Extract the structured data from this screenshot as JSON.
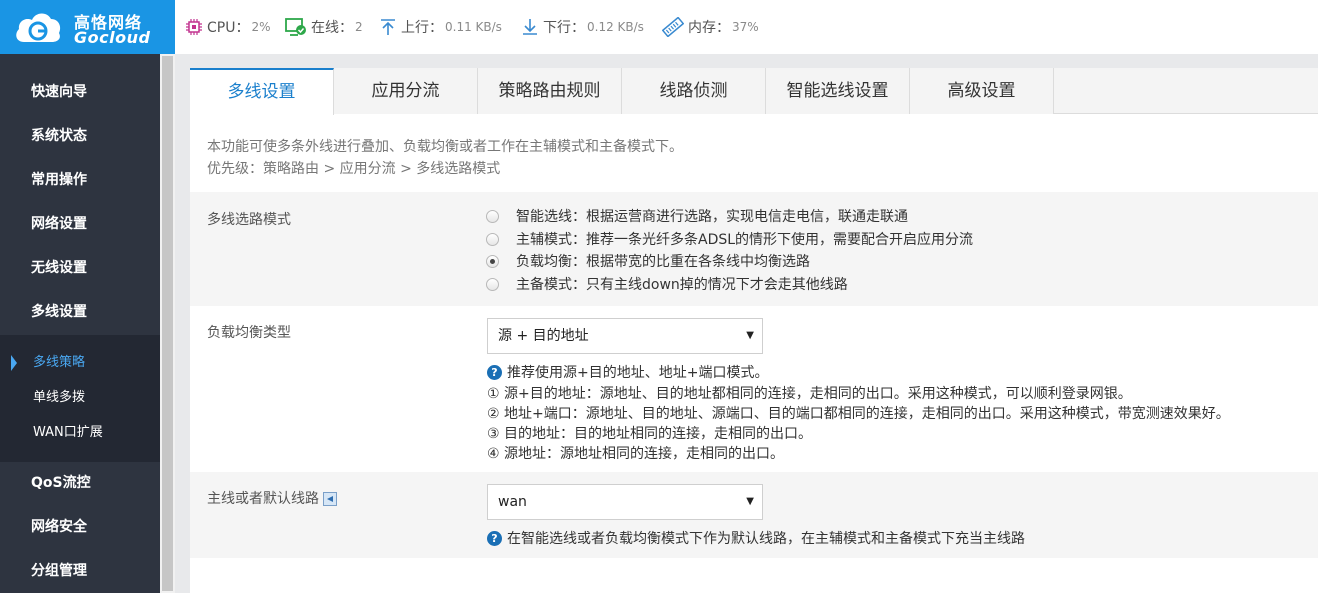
{
  "brand": {
    "name_cn": "高恪网络",
    "name_en": "Gocloud"
  },
  "status": {
    "cpu": {
      "label": "CPU：",
      "value": "2%"
    },
    "online": {
      "label": "在线：",
      "value": "2"
    },
    "upload": {
      "label": "上行：",
      "value": "0.11 KB/s"
    },
    "download": {
      "label": "下行：",
      "value": "0.12 KB/s"
    },
    "memory": {
      "label": "内存：",
      "value": "37%"
    }
  },
  "sidebar": {
    "items": [
      {
        "label": "快速向导"
      },
      {
        "label": "系统状态"
      },
      {
        "label": "常用操作"
      },
      {
        "label": "网络设置"
      },
      {
        "label": "无线设置"
      },
      {
        "label": "多线设置"
      }
    ],
    "sub_items": [
      {
        "label": "多线策略",
        "active": true
      },
      {
        "label": "单线多拨"
      },
      {
        "label": "WAN口扩展"
      }
    ],
    "items_after": [
      {
        "label": "QoS流控"
      },
      {
        "label": "网络安全"
      },
      {
        "label": "分组管理"
      }
    ]
  },
  "tabs": [
    {
      "label": "多线设置",
      "active": true
    },
    {
      "label": "应用分流"
    },
    {
      "label": "策略路由规则"
    },
    {
      "label": "线路侦测"
    },
    {
      "label": "智能选线设置"
    },
    {
      "label": "高级设置"
    }
  ],
  "description": {
    "line1": "本功能可使多条外线进行叠加、负载均衡或者工作在主辅模式和主备模式下。",
    "line2": "优先级：策略路由 > 应用分流 > 多线选路模式"
  },
  "mode_section": {
    "label": "多线选路模式",
    "options": [
      {
        "label": "智能选线：根据运营商进行选路，实现电信走电信，联通走联通",
        "checked": false
      },
      {
        "label": "主辅模式：推荐一条光纤多条ADSL的情形下使用，需要配合开启应用分流",
        "checked": false
      },
      {
        "label": "负载均衡：根据带宽的比重在各条线中均衡选路",
        "checked": true
      },
      {
        "label": "主备模式：只有主线down掉的情况下才会走其他线路",
        "checked": false
      }
    ]
  },
  "balance_section": {
    "label": "负载均衡类型",
    "select_value": "源 + 目的地址",
    "help": "推荐使用源+目的地址、地址+端口模式。",
    "notes": [
      "① 源+目的地址：源地址、目的地址都相同的连接，走相同的出口。采用这种模式，可以顺利登录网银。",
      "② 地址+端口：源地址、目的地址、源端口、目的端口都相同的连接，走相同的出口。采用这种模式，带宽测速效果好。",
      "③ 目的地址：目的地址相同的连接，走相同的出口。",
      "④ 源地址：源地址相同的连接，走相同的出口。"
    ]
  },
  "default_line_section": {
    "label": "主线或者默认线路",
    "select_value": "wan",
    "help": "在智能选线或者负载均衡模式下作为默认线路，在主辅模式和主备模式下充当主线路"
  },
  "colors": {
    "brand": "#1a95e4",
    "sidebar": "#2e3440",
    "accent": "#1a7fcc",
    "online": "#2ea84a",
    "cpu": "#c2338f"
  }
}
